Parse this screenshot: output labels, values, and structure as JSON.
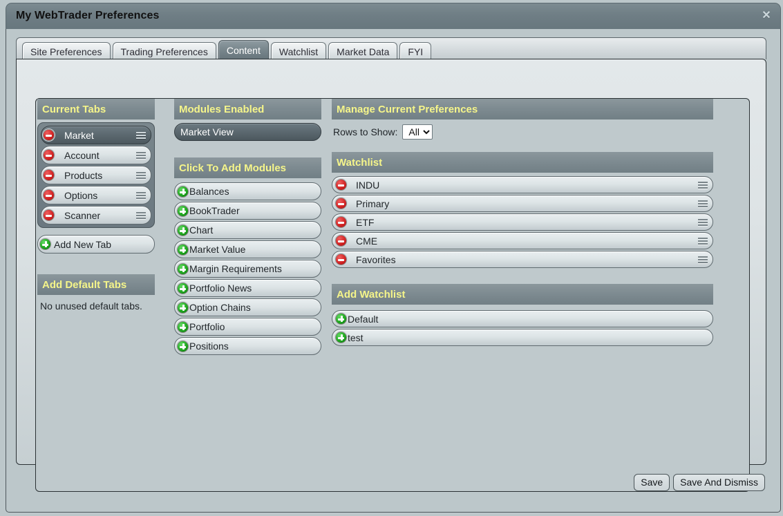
{
  "window": {
    "title": "My WebTrader Preferences",
    "close_icon": "close-icon",
    "close_glyph": "✕"
  },
  "tabs": [
    {
      "label": "Site Preferences",
      "active": false
    },
    {
      "label": "Trading Preferences",
      "active": false
    },
    {
      "label": "Content",
      "active": true
    },
    {
      "label": "Watchlist",
      "active": false
    },
    {
      "label": "Market Data",
      "active": false
    },
    {
      "label": "FYI",
      "active": false
    }
  ],
  "current_tabs": {
    "header": "Current Tabs",
    "items": [
      {
        "label": "Market",
        "selected": true,
        "remove_icon": "minus-circle-icon",
        "handle_icon": "drag-handle-icon"
      },
      {
        "label": "Account",
        "selected": false,
        "remove_icon": "minus-circle-icon",
        "handle_icon": "drag-handle-icon"
      },
      {
        "label": "Products",
        "selected": false,
        "remove_icon": "minus-circle-icon",
        "handle_icon": "drag-handle-icon"
      },
      {
        "label": "Options",
        "selected": false,
        "remove_icon": "minus-circle-icon",
        "handle_icon": "drag-handle-icon"
      },
      {
        "label": "Scanner",
        "selected": false,
        "remove_icon": "minus-circle-icon",
        "handle_icon": "drag-handle-icon"
      }
    ],
    "add_new_tab": {
      "label": "Add New Tab",
      "icon": "plus-circle-icon"
    }
  },
  "add_default_tabs": {
    "header": "Add Default Tabs",
    "empty_text": "No unused default tabs."
  },
  "modules_enabled": {
    "header": "Modules Enabled",
    "items": [
      {
        "label": "Market View",
        "selected": true
      }
    ]
  },
  "click_to_add_modules": {
    "header": "Click To Add Modules",
    "items": [
      {
        "label": "Balances",
        "icon": "plus-circle-icon"
      },
      {
        "label": "BookTrader",
        "icon": "plus-circle-icon"
      },
      {
        "label": "Chart",
        "icon": "plus-circle-icon"
      },
      {
        "label": "Market Value",
        "icon": "plus-circle-icon"
      },
      {
        "label": "Margin Requirements",
        "icon": "plus-circle-icon"
      },
      {
        "label": "Portfolio News",
        "icon": "plus-circle-icon"
      },
      {
        "label": "Option Chains",
        "icon": "plus-circle-icon"
      },
      {
        "label": "Portfolio",
        "icon": "plus-circle-icon"
      },
      {
        "label": "Positions",
        "icon": "plus-circle-icon"
      }
    ]
  },
  "manage_current_preferences": {
    "header": "Manage Current Preferences",
    "rows_to_show_label": "Rows to Show:",
    "rows_to_show_value": "All",
    "rows_to_show_options": [
      "All"
    ]
  },
  "watchlist": {
    "header": "Watchlist",
    "items": [
      {
        "label": "INDU",
        "remove_icon": "minus-circle-icon",
        "handle_icon": "drag-handle-icon"
      },
      {
        "label": "Primary",
        "remove_icon": "minus-circle-icon",
        "handle_icon": "drag-handle-icon"
      },
      {
        "label": "ETF",
        "remove_icon": "minus-circle-icon",
        "handle_icon": "drag-handle-icon"
      },
      {
        "label": "CME",
        "remove_icon": "minus-circle-icon",
        "handle_icon": "drag-handle-icon"
      },
      {
        "label": "Favorites",
        "remove_icon": "minus-circle-icon",
        "handle_icon": "drag-handle-icon"
      }
    ]
  },
  "add_watchlist": {
    "header": "Add Watchlist",
    "items": [
      {
        "label": "Default",
        "icon": "plus-circle-icon"
      },
      {
        "label": "test",
        "icon": "plus-circle-icon"
      }
    ]
  },
  "footer": {
    "save_label": "Save",
    "save_and_dismiss_label": "Save And Dismiss"
  },
  "colors": {
    "page_background": "#bcc7ca",
    "titlebar": "#6f7e85",
    "section_header_bg": "#7d8a90",
    "section_header_text": "#f5f58a",
    "selected_item_bg": "#5d6a71",
    "selected_item_text": "#ffffff",
    "remove_icon": "#d42525",
    "add_icon": "#1fa81f",
    "body_text": "#1f2428"
  }
}
